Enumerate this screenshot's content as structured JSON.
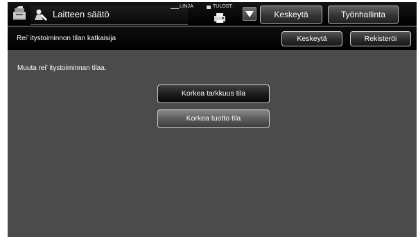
{
  "header": {
    "title": "Laitteen säätö",
    "linja_label": "LINJA",
    "tulost_label": "TULOST.",
    "keskeyta_label": "Keskeytä",
    "tyonhallinta_label": "Työnhallinta",
    "icons": [
      "copier-icon",
      "user-settings-icon",
      "printer-icon",
      "dropdown-arrow-icon"
    ]
  },
  "subheader": {
    "title": "Rei’ itystoiminnon tilan katkaisija",
    "keskeyta_label": "Keskeytä",
    "rekisteroi_label": "Rekisteröi"
  },
  "main": {
    "instruction": "Muuta rei’ itystoiminnan tilaa.",
    "options": [
      {
        "label": "Korkea tarkkuus tila",
        "selected": false
      },
      {
        "label": "Korkea tuotto tila",
        "selected": true
      }
    ]
  },
  "colors": {
    "screen_bg": "#4b4b4b",
    "bar_bg": "#000000",
    "text": "#ffffff"
  }
}
